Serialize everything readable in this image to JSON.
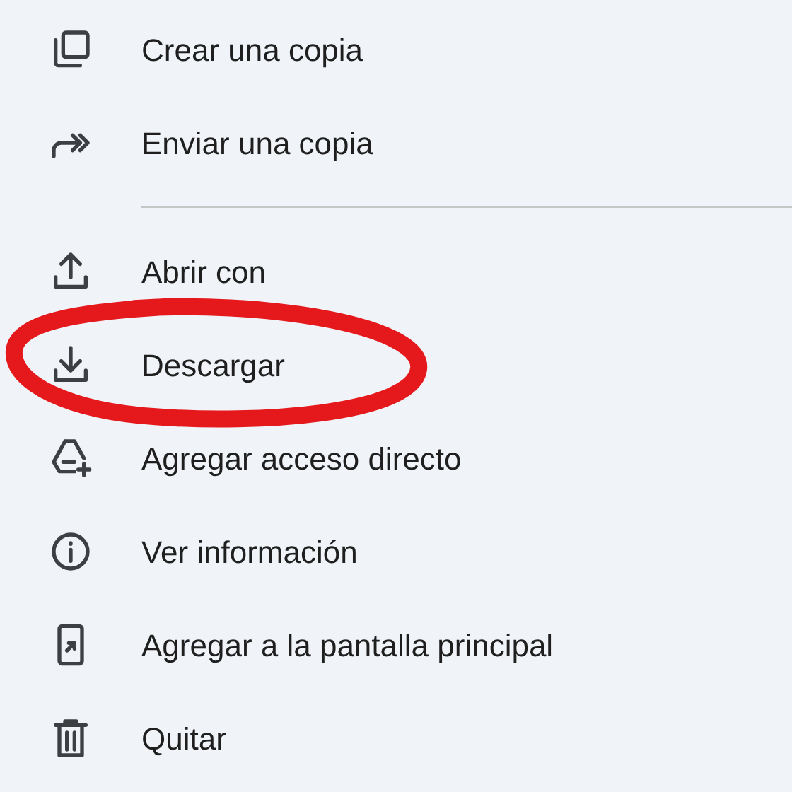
{
  "menu": {
    "sections": [
      [
        {
          "label": "Crear una copia",
          "circled": false
        },
        {
          "label": "Enviar una copia",
          "circled": false
        }
      ],
      [
        {
          "label": "Abrir con",
          "circled": false
        },
        {
          "label": "Descargar",
          "circled": true
        },
        {
          "label": "Agregar acceso directo",
          "circled": false
        },
        {
          "label": "Ver información",
          "circled": false
        },
        {
          "label": "Agregar a la pantalla principal",
          "circled": false
        },
        {
          "label": "Quitar",
          "circled": false
        }
      ]
    ]
  }
}
